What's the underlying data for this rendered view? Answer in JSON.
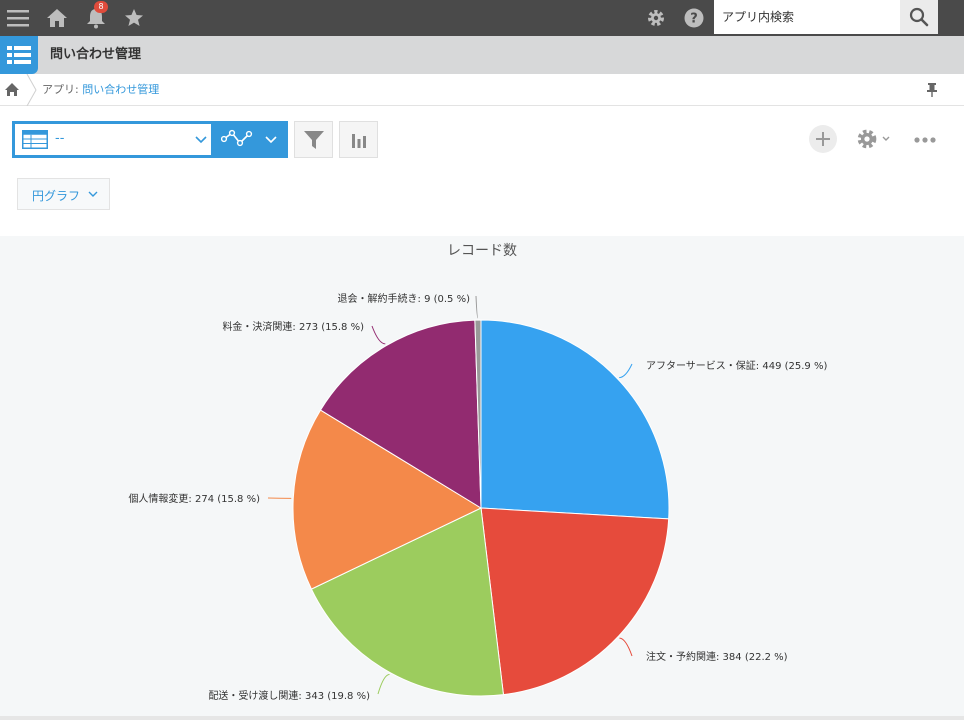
{
  "topbar": {
    "notification_count": "8",
    "search_placeholder": "アプリ内検索"
  },
  "app": {
    "title": "問い合わせ管理"
  },
  "breadcrumb": {
    "prefix": "アプリ: ",
    "app_link": "問い合わせ管理"
  },
  "toolbar": {
    "view_value": "--",
    "chart_type_label": "円グラフ"
  },
  "colors": {
    "accent": "#3498db",
    "topbar": "#4a4a4a"
  },
  "icons": [
    "menu-icon",
    "home-icon",
    "bell-icon",
    "star-icon",
    "gear-icon",
    "help-icon",
    "search-icon",
    "list-icon",
    "pin-icon",
    "table-icon",
    "graph-icon",
    "filter-icon",
    "bar-chart-icon",
    "plus-icon",
    "more-icon"
  ],
  "chart_data": {
    "type": "pie",
    "title": "レコード数",
    "categories": [
      "アフターサービス・保証",
      "注文・予約関連",
      "配送・受け渡し関連",
      "個人情報変更",
      "料金・決済関連",
      "退会・解約手続き"
    ],
    "values": [
      449,
      384,
      343,
      274,
      273,
      9
    ],
    "labels": [
      "アフターサービス・保証: 449 (25.9 %)",
      "注文・予約関連: 384 (22.2 %)",
      "配送・受け渡し関連: 343 (19.8 %)",
      "個人情報変更: 274 (15.8 %)",
      "料金・決済関連: 273 (15.8 %)",
      "退会・解約手続き: 9 (0.5 %)"
    ],
    "colors": [
      "#36a2f0",
      "#e64b3c",
      "#9ccc5e",
      "#f4894a",
      "#922b70",
      "#999999"
    ]
  }
}
